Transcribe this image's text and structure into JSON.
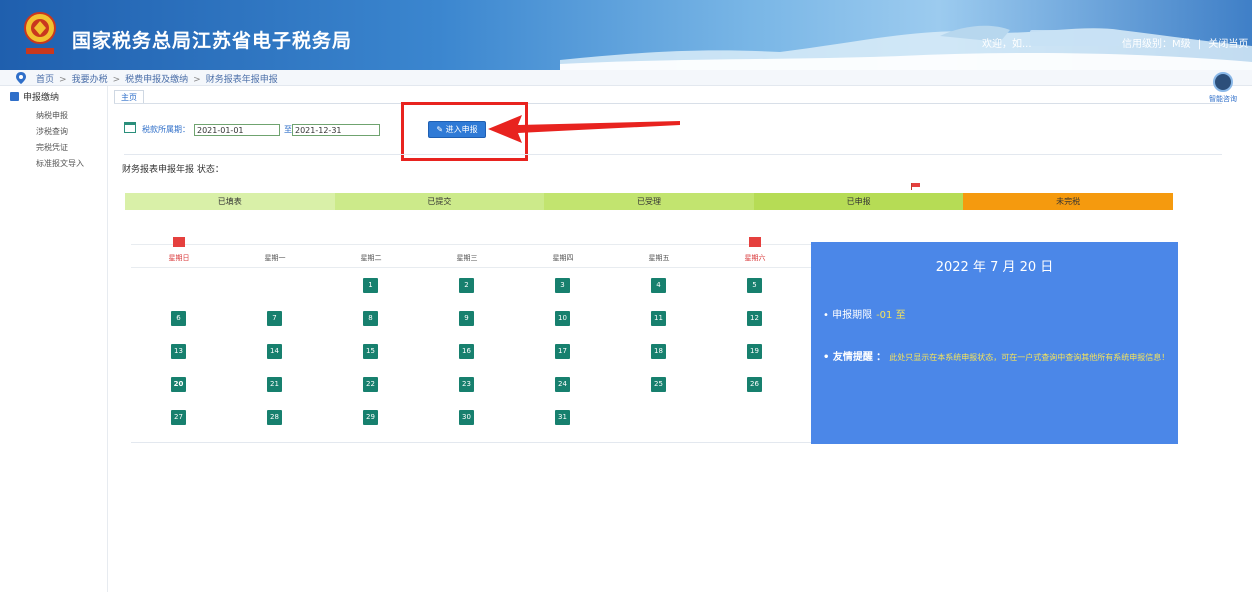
{
  "header": {
    "title": "国家税务总局江苏省电子税务局",
    "welcome": "欢迎，如...",
    "credit": "信用级别：M级",
    "divider": "|",
    "close": "关闭当页"
  },
  "breadcrumb": {
    "items": [
      "首页",
      "我要办税",
      "税费申报及缴纳",
      "财务报表年报申报"
    ],
    "separator": ">"
  },
  "sidebar": {
    "heading": "申报缴纳",
    "items": [
      "纳税申报",
      "涉税查询",
      "完税凭证",
      "标准报文导入"
    ]
  },
  "helper": {
    "label": "智能咨询"
  },
  "tab": {
    "label": "主页"
  },
  "form": {
    "period_label": "税款所属期：",
    "start_date": "2021-01-01",
    "to_label": "至",
    "end_date": "2021-12-31",
    "enter_button": "进入申报"
  },
  "status": {
    "title": "财务报表申报年报 状态：",
    "segments": [
      {
        "label": "已填表",
        "color": "#d9f0a8"
      },
      {
        "label": "已提交",
        "color": "#ccea8a"
      },
      {
        "label": "已受理",
        "color": "#c2e46f"
      },
      {
        "label": "已申报",
        "color": "#b6dc55"
      },
      {
        "label": "未完税",
        "color": "#f59a0e"
      }
    ]
  },
  "calendar": {
    "weekdays": [
      "星期日",
      "星期一",
      "星期二",
      "星期三",
      "星期四",
      "星期五",
      "星期六"
    ],
    "first_weekday": 2,
    "days_in_month": 31,
    "today": 20
  },
  "info": {
    "date": "2022 年 7 月 20 日",
    "deadline_label": "• 申报期限",
    "deadline_value": "-01  至",
    "remind_label": "• 友情提醒",
    "remind_sep": "：",
    "remind_text": "此处只显示在本系统申报状态，可在一户式查询中查询其他所有系统申报信息！"
  },
  "colors": {
    "accent": "#2f7ad6",
    "highlight": "#e8231f",
    "calendar_day": "#17806e",
    "info_panel": "#4b87e8"
  }
}
